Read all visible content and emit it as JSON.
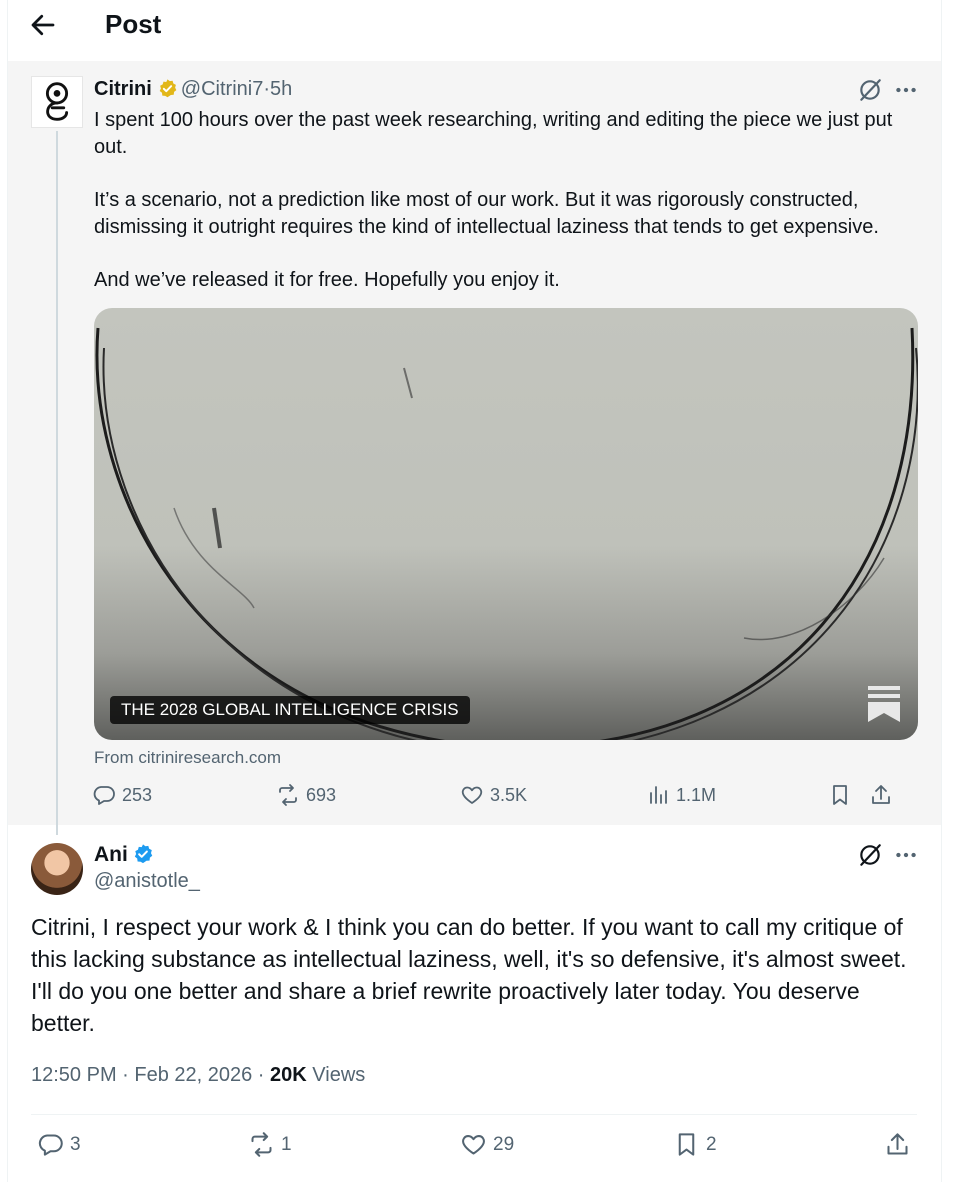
{
  "header": {
    "title": "Post"
  },
  "quoted_post": {
    "author_name": "Citrini",
    "handle": "@Citrini7",
    "separator": "·",
    "time": "5h",
    "paragraphs": [
      "I spent 100 hours over the past week researching, writing and editing the piece we just put out.",
      "It’s a scenario, not a prediction like most of our work. But it was rigorously constructed, dismissing it outright requires the kind of intellectual laziness that tends to get expensive.",
      "And we’ve released it for free. Hopefully you enjoy it."
    ],
    "card": {
      "title": "THE 2028 GLOBAL INTELLIGENCE CRISIS",
      "source": "From citriniresearch.com",
      "icon": "substack-icon"
    },
    "actions": {
      "replies": "253",
      "reposts": "693",
      "likes": "3.5K",
      "views": "1.1M"
    },
    "badge_color": "#e2b719"
  },
  "reply_post": {
    "author_name": "Ani",
    "handle": "@anistotle_",
    "text": "Citrini, I respect your work & I think you can do better. If you want to call my critique of this lacking substance as intellectual laziness, well, it's so defensive, it's almost sweet. I'll do you one better and share a brief rewrite proactively later today. You deserve better.",
    "timestamp": "12:50 PM · Feb 22, 2026 · ",
    "views_count": "20K",
    "views_label": " Views",
    "actions": {
      "replies": "3",
      "reposts": "1",
      "likes": "29",
      "bookmarks": "2"
    },
    "badge_color": "#1d9bf0"
  },
  "colors": {
    "text_primary": "#0f1419",
    "text_secondary": "#536471",
    "quoted_background": "#f5f5f5",
    "border": "#eff3f4"
  }
}
